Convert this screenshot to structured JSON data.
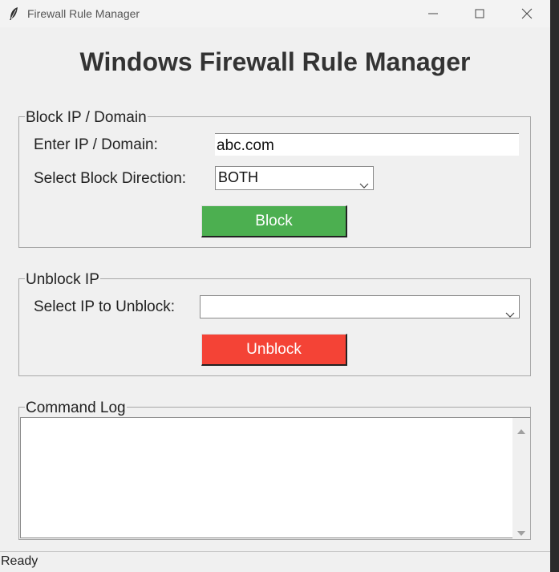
{
  "window": {
    "title": "Firewall Rule Manager"
  },
  "heading": "Windows Firewall Rule Manager",
  "block_section": {
    "group_title": "Block IP / Domain",
    "ip_label": "Enter IP / Domain:",
    "ip_value": "abc.com",
    "direction_label": "Select Block Direction:",
    "direction_selected": "BOTH",
    "block_button": "Block",
    "block_color": "#4caf50"
  },
  "unblock_section": {
    "group_title": "Unblock IP",
    "select_label": "Select IP to Unblock:",
    "selected_ip": "",
    "unblock_button": "Unblock",
    "unblock_color": "#f44336"
  },
  "log_section": {
    "group_title": "Command Log"
  },
  "status": "Ready",
  "icons": [
    "feather-icon",
    "minimize-icon",
    "maximize-icon",
    "close-icon",
    "chevron-down-icon",
    "scroll-up-icon",
    "scroll-down-icon"
  ]
}
